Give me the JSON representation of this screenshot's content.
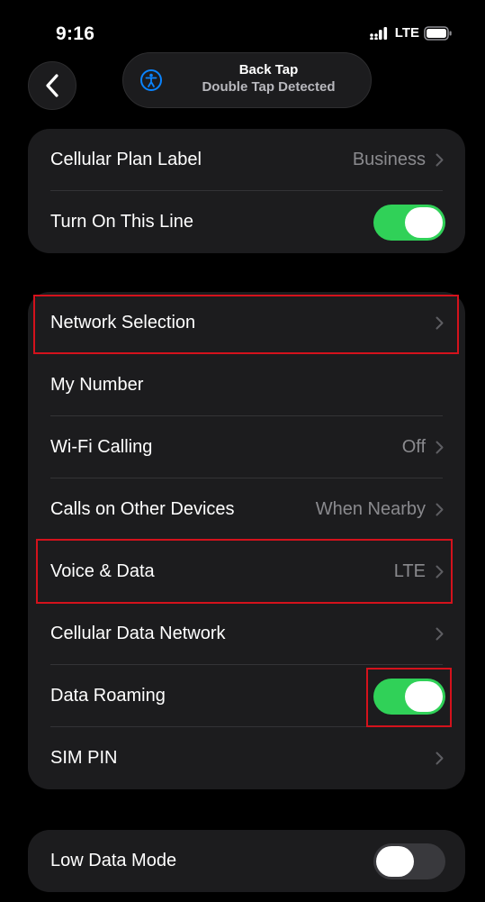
{
  "status_bar": {
    "time": "9:16",
    "network": "LTE",
    "icons": [
      "signal-icon",
      "battery-icon"
    ]
  },
  "nav": {
    "back_icon": "chevron-left-icon"
  },
  "hud": {
    "icon": "accessibility-icon",
    "title": "Back Tap",
    "subtitle": "Double Tap Detected"
  },
  "group1": {
    "plan_label": {
      "label": "Cellular Plan Label",
      "value": "Business"
    },
    "turn_on_line": {
      "label": "Turn On This Line",
      "enabled": true
    }
  },
  "group2": {
    "network_selection": {
      "label": "Network Selection",
      "value": ""
    },
    "my_number": {
      "label": "My Number"
    },
    "wifi_calling": {
      "label": "Wi-Fi Calling",
      "value": "Off"
    },
    "calls_other_devices": {
      "label": "Calls on Other Devices",
      "value": "When Nearby"
    },
    "voice_data": {
      "label": "Voice & Data",
      "value": "LTE"
    },
    "cellular_data_network": {
      "label": "Cellular Data Network",
      "value": ""
    },
    "data_roaming": {
      "label": "Data Roaming",
      "enabled": true
    },
    "sim_pin": {
      "label": "SIM PIN",
      "value": ""
    }
  },
  "group3": {
    "low_data_mode": {
      "label": "Low Data Mode",
      "enabled": false
    }
  },
  "colors": {
    "background": "#000000",
    "cell": "#1c1c1e",
    "toggle_on": "#30d158",
    "toggle_off": "#39393d",
    "value_text": "#8a8a8e",
    "highlight": "#d4121c"
  }
}
